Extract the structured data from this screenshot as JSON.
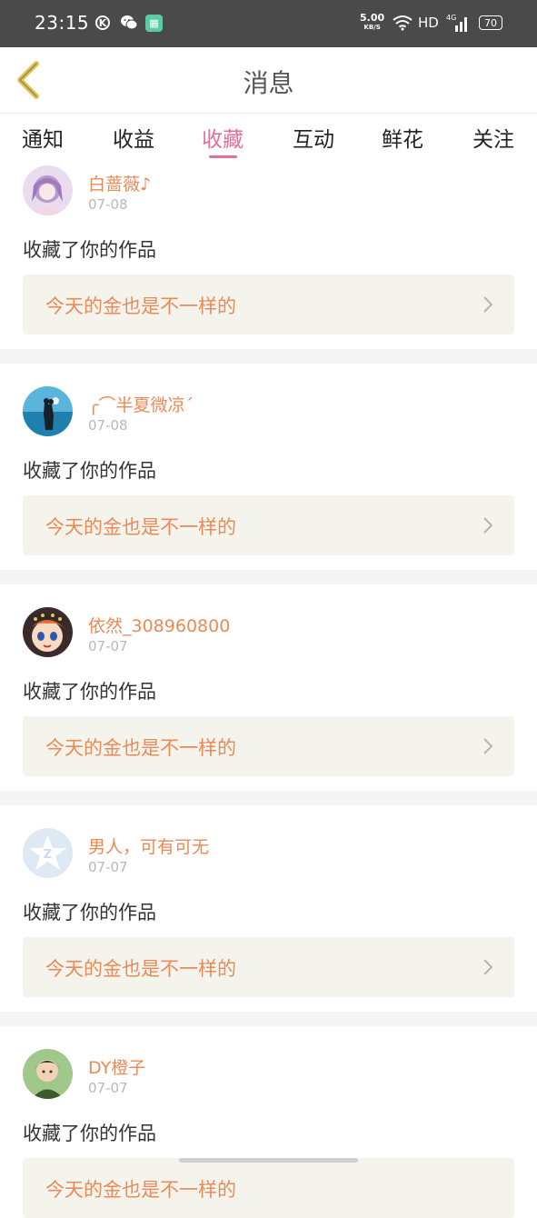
{
  "status_bar": {
    "time": "23:15",
    "k_icon": "K",
    "speed_value": "5.00",
    "speed_unit": "KB/S",
    "hd": "HD",
    "network": "4G",
    "battery": "70"
  },
  "header": {
    "title": "消息",
    "back_icon": "chevron-left-icon"
  },
  "tabs": [
    {
      "label": "通知",
      "active": false
    },
    {
      "label": "收益",
      "active": false
    },
    {
      "label": "收藏",
      "active": true
    },
    {
      "label": "互动",
      "active": false
    },
    {
      "label": "鲜花",
      "active": false
    },
    {
      "label": "关注",
      "active": false
    }
  ],
  "accent_color": "#e86e9a",
  "name_color": "#ea8a57",
  "items": [
    {
      "username": "白蔷薇♪",
      "date": "07-08",
      "action": "收藏了你的作品",
      "work": "今天的金也是不一样的",
      "avatar": "anime-girl-purple"
    },
    {
      "username": "╭⌒半夏微凉ˊ",
      "date": "07-08",
      "action": "收藏了你的作品",
      "work": "今天的金也是不一样的",
      "avatar": "sea-silhouette"
    },
    {
      "username": "依然_308960800",
      "date": "07-07",
      "action": "收藏了你的作品",
      "work": "今天的金也是不一样的",
      "avatar": "doll-face"
    },
    {
      "username": "男人，可有可无",
      "date": "07-07",
      "action": "收藏了你的作品",
      "work": "今天的金也是不一样的",
      "avatar": "default-star"
    },
    {
      "username": "DY橙子",
      "date": "07-07",
      "action": "收藏了你的作品",
      "work": "今天的金也是不一样的",
      "avatar": "green-boy"
    }
  ]
}
